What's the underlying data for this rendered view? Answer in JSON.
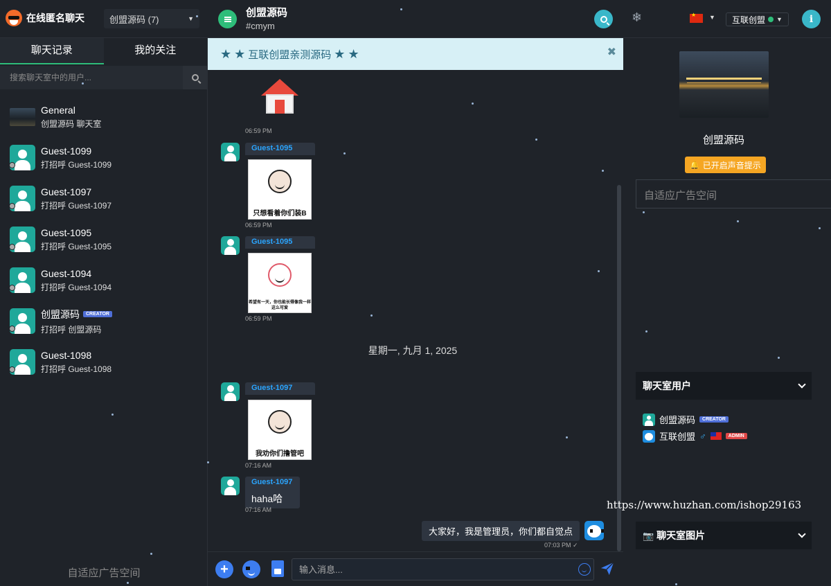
{
  "header": {
    "app_title": "在线匿名聊天",
    "room_selector": "创盟源码 (7)",
    "chat_title": "创盟源码",
    "chat_handle": "#cmym",
    "username": "互联创盟"
  },
  "left": {
    "tabs": [
      {
        "label": "聊天记录"
      },
      {
        "label": "我的关注"
      }
    ],
    "search_placeholder": "搜索聊天室中的用户...",
    "conversations": [
      {
        "name": "General",
        "sub": "创盟源码 聊天室"
      },
      {
        "name": "Guest-1099",
        "sub": "打招呼 Guest-1099"
      },
      {
        "name": "Guest-1097",
        "sub": "打招呼 Guest-1097"
      },
      {
        "name": "Guest-1095",
        "sub": "打招呼 Guest-1095"
      },
      {
        "name": "Guest-1094",
        "sub": "打招呼 Guest-1094"
      },
      {
        "name": "创盟源码",
        "sub": "打招呼 创盟源码",
        "badge": "CREATOR"
      },
      {
        "name": "Guest-1098",
        "sub": "打招呼 Guest-1098"
      }
    ],
    "ad_text": "自适应广告空间"
  },
  "chat": {
    "pinned_text": "互联创盟亲测源码",
    "messages": [
      {
        "time": "06:59 PM"
      },
      {
        "user": "Guest-1095",
        "time": "06:59 PM",
        "caption": "只想看着你们装B"
      },
      {
        "user": "Guest-1095",
        "time": "06:59 PM",
        "caption": "希望有一天，你也能长得像我一样这么可爱"
      },
      {
        "user": "Guest-1097",
        "time": "07:16 AM",
        "caption": "我劝你们撸管吧"
      },
      {
        "user": "Guest-1097",
        "time": "07:16 AM",
        "text": "haha哈"
      },
      {
        "time": "07:03 PM",
        "text": "大家好，我是管理员，你们都自觉点"
      }
    ],
    "date_separator": "星期一, 九月 1, 2025",
    "input_placeholder": "输入消息..."
  },
  "right": {
    "room_name": "创盟源码",
    "sound_notice": "已开启声音提示",
    "ad_text": "自适应广告空间",
    "users_panel_title": "聊天室用户",
    "room_users": [
      {
        "name": "创盟源码",
        "badge": "CREATOR"
      },
      {
        "name": "互联创盟",
        "badge": "ADMIN"
      }
    ],
    "images_panel_title": "聊天室图片"
  },
  "watermark": "https://www.huzhan.com/ishop29163",
  "colors": {
    "accent_green": "#2ebd7a",
    "accent_cyan": "#3ab7c9",
    "accent_blue": "#3d7df0",
    "pinned_bg": "#d7f0f6",
    "creator_badge": "#4f6fd8",
    "admin_badge": "#e04848",
    "notice": "#f5a623"
  }
}
